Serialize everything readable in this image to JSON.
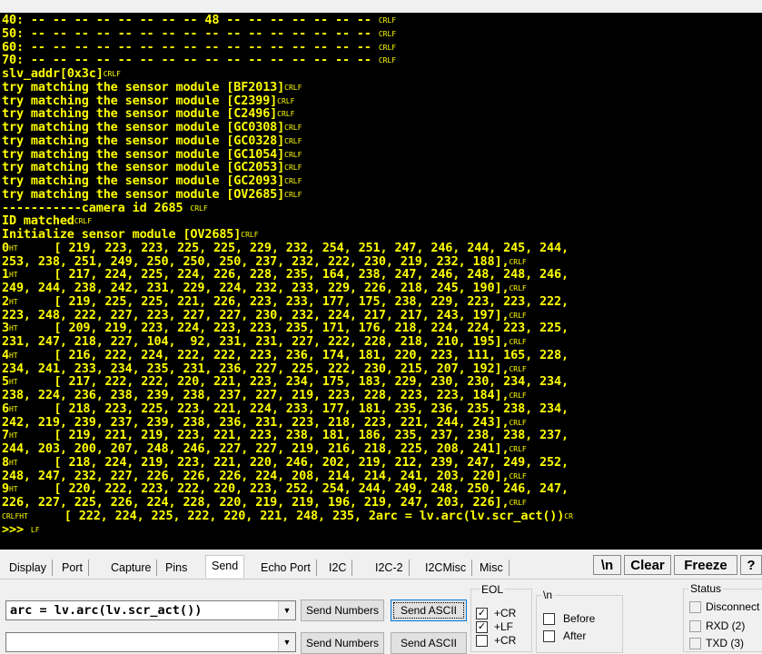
{
  "terminal": {
    "lines": [
      {
        "text": "40: -- -- -- -- -- -- -- -- 48 -- -- -- -- -- -- -- ",
        "ctl": "CRLF"
      },
      {
        "text": "50: -- -- -- -- -- -- -- -- -- -- -- -- -- -- -- -- ",
        "ctl": "CRLF"
      },
      {
        "text": "60: -- -- -- -- -- -- -- -- -- -- -- -- -- -- -- -- ",
        "ctl": "CRLF"
      },
      {
        "text": "70: -- -- -- -- -- -- -- -- -- -- -- -- -- -- -- -- ",
        "ctl": "CRLF"
      },
      {
        "text": "slv_addr[0x3c]",
        "ctl": "CRLF"
      },
      {
        "text": "try matching the sensor module [BF2013]",
        "ctl": "CRLF"
      },
      {
        "text": "try matching the sensor module [C2399]",
        "ctl": "CRLF"
      },
      {
        "text": "try matching the sensor module [C2496]",
        "ctl": "CRLF"
      },
      {
        "text": "try matching the sensor module [GC0308]",
        "ctl": "CRLF"
      },
      {
        "text": "try matching the sensor module [GC0328]",
        "ctl": "CRLF"
      },
      {
        "text": "try matching the sensor module [GC1054]",
        "ctl": "CRLF"
      },
      {
        "text": "try matching the sensor module [GC2053]",
        "ctl": "CRLF"
      },
      {
        "text": "try matching the sensor module [GC2093]",
        "ctl": "CRLF"
      },
      {
        "text": "try matching the sensor module [OV2685]",
        "ctl": "CRLF"
      },
      {
        "text": "-----------camera id 2685 ",
        "ctl": "CRLF"
      },
      {
        "text": "ID matched",
        "ctl": "CRLF"
      },
      {
        "text": "Initialize sensor module [OV2685]",
        "ctl": "CRLF"
      },
      {
        "text": "0",
        "ctl": "HT",
        "text2": "     [ 219, 223, 223, 225, 225, 229, 232, 254, 251, 247, 246, 244, 245, 244,"
      },
      {
        "text": "253, 238, 251, 249, 250, 250, 250, 237, 232, 222, 230, 219, 232, 188],",
        "ctl": "CRLF"
      },
      {
        "text": "1",
        "ctl": "HT",
        "text2": "     [ 217, 224, 225, 224, 226, 228, 235, 164, 238, 247, 246, 248, 248, 246,"
      },
      {
        "text": "249, 244, 238, 242, 231, 229, 224, 232, 233, 229, 226, 218, 245, 190],",
        "ctl": "CRLF"
      },
      {
        "text": "2",
        "ctl": "HT",
        "text2": "     [ 219, 225, 225, 221, 226, 223, 233, 177, 175, 238, 229, 223, 223, 222,"
      },
      {
        "text": "223, 248, 222, 227, 223, 227, 227, 230, 232, 224, 217, 217, 243, 197],",
        "ctl": "CRLF"
      },
      {
        "text": "3",
        "ctl": "HT",
        "text2": "     [ 209, 219, 223, 224, 223, 223, 235, 171, 176, 218, 224, 224, 223, 225,"
      },
      {
        "text": "231, 247, 218, 227, 104,  92, 231, 231, 227, 222, 228, 218, 210, 195],",
        "ctl": "CRLF"
      },
      {
        "text": "4",
        "ctl": "HT",
        "text2": "     [ 216, 222, 224, 222, 222, 223, 236, 174, 181, 220, 223, 111, 165, 228,"
      },
      {
        "text": "234, 241, 233, 234, 235, 231, 236, 227, 225, 222, 230, 215, 207, 192],",
        "ctl": "CRLF"
      },
      {
        "text": "5",
        "ctl": "HT",
        "text2": "     [ 217, 222, 222, 220, 221, 223, 234, 175, 183, 229, 230, 230, 234, 234,"
      },
      {
        "text": "238, 224, 236, 238, 239, 238, 237, 227, 219, 223, 228, 223, 223, 184],",
        "ctl": "CRLF"
      },
      {
        "text": "6",
        "ctl": "HT",
        "text2": "     [ 218, 223, 225, 223, 221, 224, 233, 177, 181, 235, 236, 235, 238, 234,"
      },
      {
        "text": "242, 219, 239, 237, 239, 238, 236, 231, 223, 218, 223, 221, 244, 243],",
        "ctl": "CRLF"
      },
      {
        "text": "7",
        "ctl": "HT",
        "text2": "     [ 219, 221, 219, 223, 221, 223, 238, 181, 186, 235, 237, 238, 238, 237,"
      },
      {
        "text": "244, 203, 200, 207, 248, 246, 227, 227, 219, 216, 218, 225, 208, 241],",
        "ctl": "CRLF"
      },
      {
        "text": "8",
        "ctl": "HT",
        "text2": "     [ 218, 224, 219, 223, 221, 220, 246, 202, 219, 212, 239, 247, 249, 252,"
      },
      {
        "text": "248, 247, 232, 227, 226, 226, 226, 224, 208, 214, 214, 241, 203, 220],",
        "ctl": "CRLF"
      },
      {
        "text": "9",
        "ctl": "HT",
        "text2": "     [ 220, 222, 223, 222, 220, 223, 252, 254, 244, 249, 248, 250, 246, 247,"
      },
      {
        "text": "226, 227, 225, 226, 224, 228, 220, 219, 219, 196, 219, 247, 203, 226],",
        "ctl": "CRLF"
      },
      {
        "text": "",
        "ctl": "CRLFHT",
        "text2": "     [ 222, 224, 225, 222, 220, 221, 248, 235, 2arc = lv.arc(lv.scr_act())",
        "tail": "CR"
      },
      {
        "text": ">>> ",
        "ctl": "LF"
      }
    ]
  },
  "tabs": [
    {
      "label": "Display"
    },
    {
      "label": "Port"
    },
    {
      "label": "Capture"
    },
    {
      "label": "Pins"
    },
    {
      "label": "Send"
    },
    {
      "label": "Echo Port"
    },
    {
      "label": "I2C"
    },
    {
      "label": "I2C-2"
    },
    {
      "label": "I2CMisc"
    },
    {
      "label": "Misc"
    }
  ],
  "toolbar": {
    "newline_label": "\\n",
    "clear_label": "Clear",
    "freeze_label": "Freeze",
    "help_label": "?"
  },
  "send": {
    "row1_value": "arc = lv.arc(lv.scr_act())",
    "row2_value": "",
    "send_numbers_label": "Send Numbers",
    "send_ascii_label": "Send ASCII"
  },
  "eol": {
    "group_label": "EOL",
    "cr_label": "+CR",
    "lf_label": "+LF",
    "cr2_label": "+CR",
    "cr_checked": true,
    "lf_checked": true
  },
  "nl": {
    "group_label": "\\n",
    "before_label": "Before",
    "after_label": "After"
  },
  "status": {
    "group_label": "Status",
    "items": [
      "Disconnect",
      "RXD (2)",
      "TXD (3)"
    ]
  }
}
